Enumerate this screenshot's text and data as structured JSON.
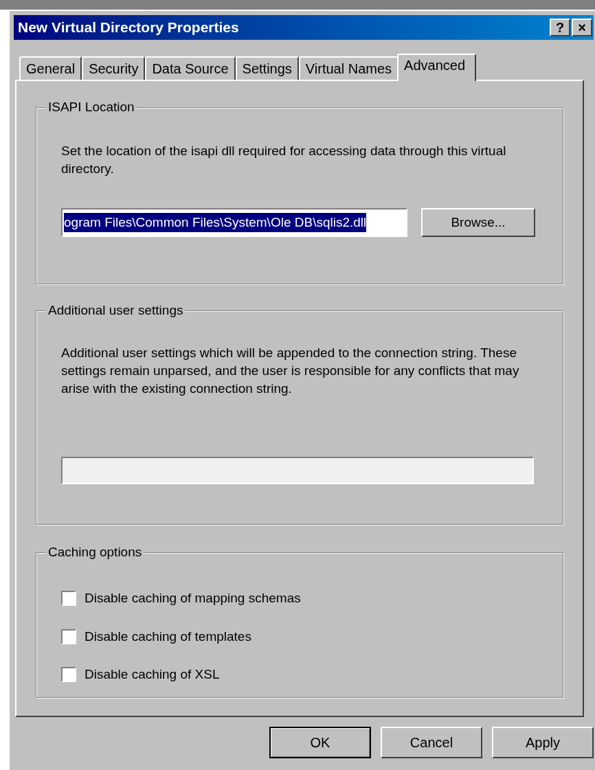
{
  "window": {
    "title": "New Virtual Directory Properties",
    "title_buttons": [
      "?",
      "×"
    ]
  },
  "tabs": [
    {
      "label": "General",
      "selected": false
    },
    {
      "label": "Security",
      "selected": false
    },
    {
      "label": "Data Source",
      "selected": false
    },
    {
      "label": "Settings",
      "selected": false
    },
    {
      "label": "Virtual Names",
      "selected": false
    },
    {
      "label": "Advanced",
      "selected": true
    }
  ],
  "isapi_location": {
    "legend": "ISAPI Location",
    "description": "Set the location of the isapi dll required for accessing data through this virtual directory.",
    "path_value": "ogram Files\\Common Files\\System\\Ole DB\\sqlis2.dll",
    "browse_button": "Browse..."
  },
  "additional_user_settings": {
    "legend": "Additional user settings",
    "description": "Additional user settings which will be appended to the connection string. These settings remain unparsed, and the user is responsible for any conflicts that may arise with the existing connection string."
  },
  "caching_options": {
    "legend": "Caching options",
    "options": [
      {
        "label": "Disable caching of mapping schemas",
        "checked": false
      },
      {
        "label": "Disable caching of templates",
        "checked": false
      },
      {
        "label": "Disable caching of XSL",
        "checked": false
      }
    ]
  },
  "buttons": [
    "OK",
    "Cancel",
    "Apply"
  ]
}
